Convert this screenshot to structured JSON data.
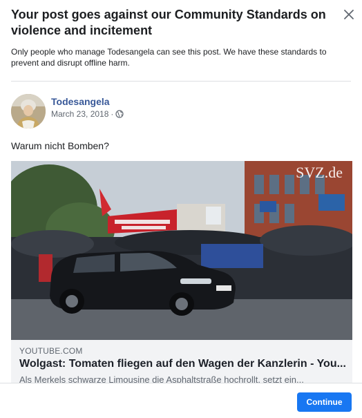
{
  "dialog": {
    "title": "Your post goes against our Community Standards on violence and incitement",
    "description": "Only people who manage Todesangela can see this post. We have these standards to prevent and disrupt offline harm.",
    "close_icon": "close-icon"
  },
  "post": {
    "author": "Todesangela",
    "date": "March 23, 2018",
    "separator": "·",
    "privacy_icon": "globe-icon",
    "text": "Warum nicht Bomben?"
  },
  "media": {
    "watermark": "SVZ.de"
  },
  "link_preview": {
    "domain": "YOUTUBE.COM",
    "title": "Wolgast: Tomaten fliegen auf den Wagen der Kanzlerin - You...",
    "description": "Als Merkels schwarze Limousine die Asphaltstraße hochrollt, setzt ein..."
  },
  "footer": {
    "continue_label": "Continue"
  },
  "colors": {
    "link_blue": "#385898",
    "button_blue": "#1877f2",
    "link_box_bg": "#f2f3f5"
  }
}
